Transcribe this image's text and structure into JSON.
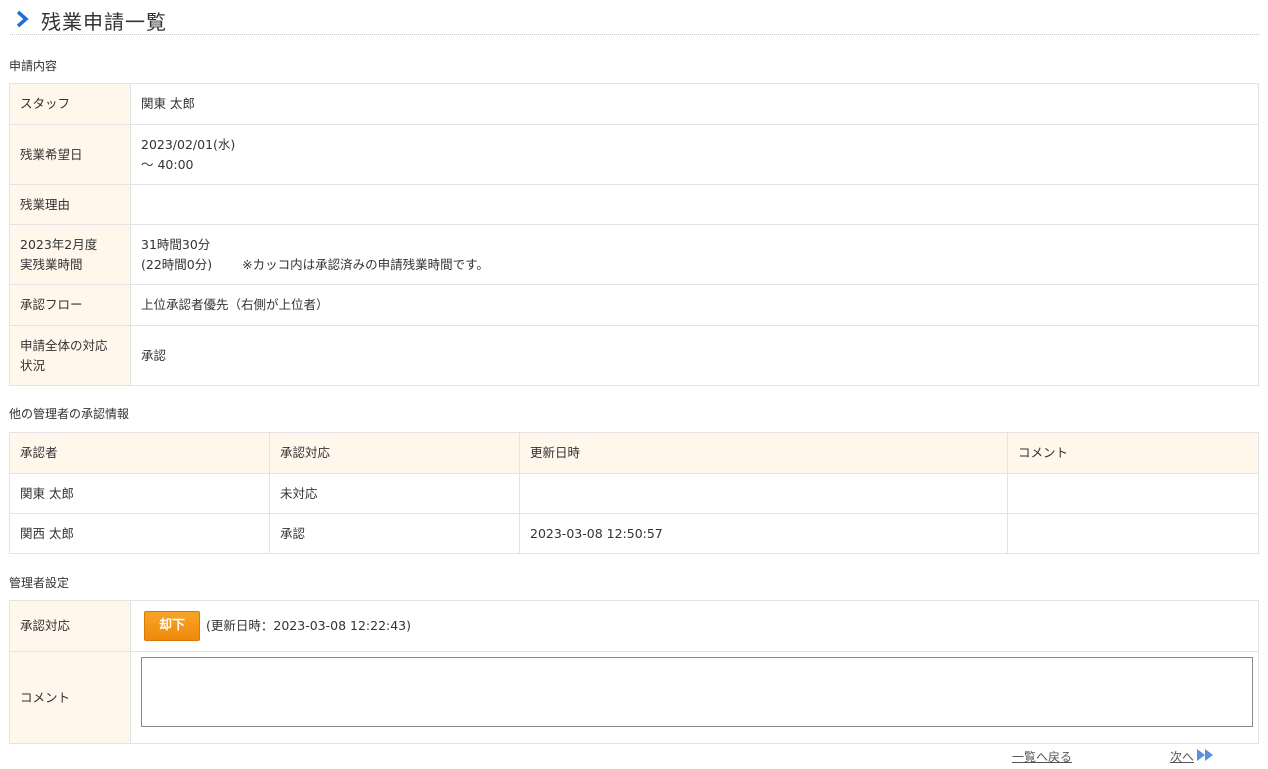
{
  "header": {
    "title": "残業申請一覧"
  },
  "sections": {
    "request": "申請内容",
    "others": "他の管理者の承認情報",
    "admin": "管理者設定"
  },
  "request": {
    "staff_label": "スタッフ",
    "staff_value": "関東 太郎",
    "date_label": "残業希望日",
    "date_value_1": "2023/02/01(水)",
    "date_value_2": "～ 40:00",
    "reason_label": "残業理由",
    "reason_value": "",
    "actual_label_1": "2023年2月度",
    "actual_label_2": "実残業時間",
    "actual_value_1": "31時間30分",
    "actual_value_2": "(22時間0分)",
    "actual_note": "※カッコ内は承認済みの申請残業時間です。",
    "flow_label": "承認フロー",
    "flow_value": "上位承認者優先（右側が上位者）",
    "status_label_1": "申請全体の対応",
    "status_label_2": "状況",
    "status_value": "承認"
  },
  "approvals": {
    "headers": [
      "承認者",
      "承認対応",
      "更新日時",
      "コメント"
    ],
    "rows": [
      {
        "approver": "関東 太郎",
        "response": "未対応",
        "updated": "",
        "comment": ""
      },
      {
        "approver": "関西 太郎",
        "response": "承認",
        "updated": "2023-03-08 12:50:57",
        "comment": ""
      }
    ]
  },
  "admin": {
    "response_label": "承認対応",
    "reject_button": "却下",
    "updated_text": "(更新日時：2023-03-08 12:22:43)",
    "comment_label": "コメント",
    "comment_value": ""
  },
  "footer": {
    "back_link": "一覧へ戻る",
    "next_link": "次へ"
  },
  "colors": {
    "accent_blue": "#1e6fd9",
    "label_bg": "#fff6ec",
    "button_orange": "#f39c1b"
  },
  "icons": {
    "title_icon": "chevron-right-icon",
    "next_icon": "double-arrow-right-icon"
  }
}
